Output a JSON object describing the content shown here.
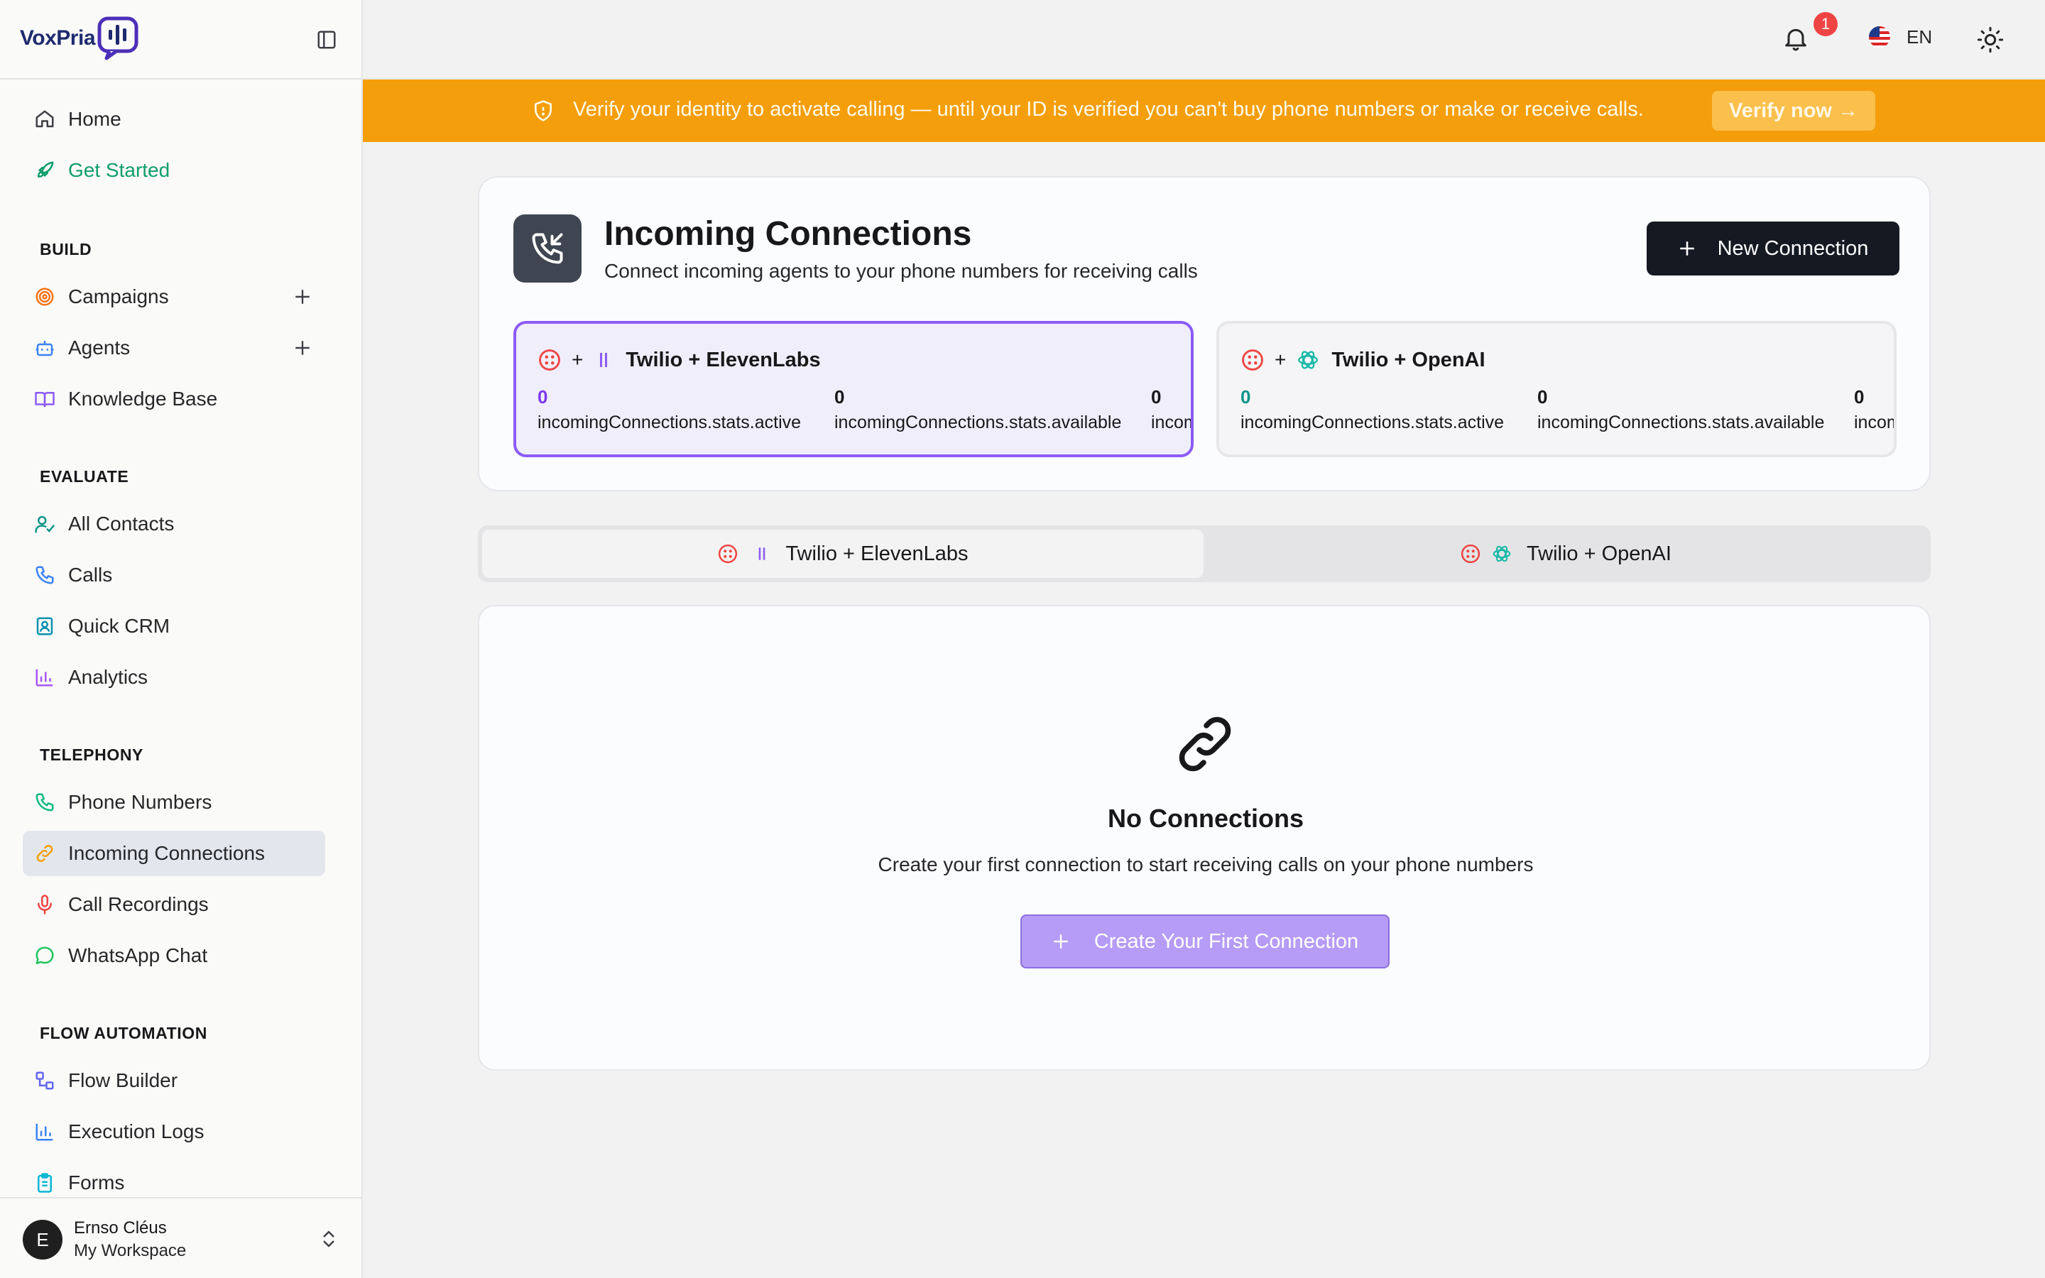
{
  "app": {
    "logo_text": "VoxPria",
    "brand_color": "#1e2a6e",
    "accent_purple": "#8b5cf6",
    "warning_color": "#f59e0b"
  },
  "sidebar": {
    "nav_top": [
      {
        "label": "Home",
        "icon": "home-icon"
      },
      {
        "label": "Get Started",
        "icon": "rocket-icon"
      }
    ],
    "sections": [
      {
        "title": "BUILD",
        "items": [
          {
            "label": "Campaigns",
            "icon": "target-icon",
            "has_add": true
          },
          {
            "label": "Agents",
            "icon": "bot-icon",
            "has_add": true
          },
          {
            "label": "Knowledge Base",
            "icon": "book-icon"
          }
        ]
      },
      {
        "title": "EVALUATE",
        "items": [
          {
            "label": "All Contacts",
            "icon": "user-check-icon"
          },
          {
            "label": "Calls",
            "icon": "phone-icon"
          },
          {
            "label": "Quick CRM",
            "icon": "contact-card-icon"
          },
          {
            "label": "Analytics",
            "icon": "bar-chart-icon"
          }
        ]
      },
      {
        "title": "TELEPHONY",
        "items": [
          {
            "label": "Phone Numbers",
            "icon": "phone-icon"
          },
          {
            "label": "Incoming Connections",
            "icon": "link-icon",
            "active": true
          },
          {
            "label": "Call Recordings",
            "icon": "mic-icon"
          },
          {
            "label": "WhatsApp Chat",
            "icon": "chat-bubble-icon"
          }
        ]
      },
      {
        "title": "FLOW AUTOMATION",
        "items": [
          {
            "label": "Flow Builder",
            "icon": "workflow-icon"
          },
          {
            "label": "Execution Logs",
            "icon": "bar-chart-icon"
          },
          {
            "label": "Forms",
            "icon": "clipboard-icon"
          }
        ]
      }
    ],
    "user": {
      "initial": "E",
      "name": "Ernso Cléus",
      "workspace": "My Workspace"
    }
  },
  "topbar": {
    "notification_count": "1",
    "language": "EN"
  },
  "banner": {
    "text": "Verify your identity to activate calling — until your ID is verified you can't buy phone numbers or make or receive calls.",
    "action": "Verify now →"
  },
  "header": {
    "title": "Incoming Connections",
    "subtitle": "Connect incoming agents to your phone numbers for receiving calls",
    "new_button": "New Connection"
  },
  "providers": [
    {
      "name": "Twilio + ElevenLabs",
      "plus": "+",
      "stats": [
        {
          "value": "0",
          "key": "incomingConnections.stats.active"
        },
        {
          "value": "0",
          "key": "incomingConnections.stats.available"
        },
        {
          "value": "0",
          "key": "incomingConnections.stats.agents"
        }
      ]
    },
    {
      "name": "Twilio + OpenAI",
      "plus": "+",
      "stats": [
        {
          "value": "0",
          "key": "incomingConnections.stats.active"
        },
        {
          "value": "0",
          "key": "incomingConnections.stats.available"
        },
        {
          "value": "0",
          "key": "incomingConnections.stats.agents"
        }
      ]
    }
  ],
  "tabs": [
    {
      "label": "Twilio + ElevenLabs",
      "selected": true
    },
    {
      "label": "Twilio + OpenAI",
      "selected": false
    }
  ],
  "empty_state": {
    "title": "No Connections",
    "subtitle": "Create your first connection to start receiving calls on your phone numbers",
    "button": "Create Your First Connection"
  }
}
